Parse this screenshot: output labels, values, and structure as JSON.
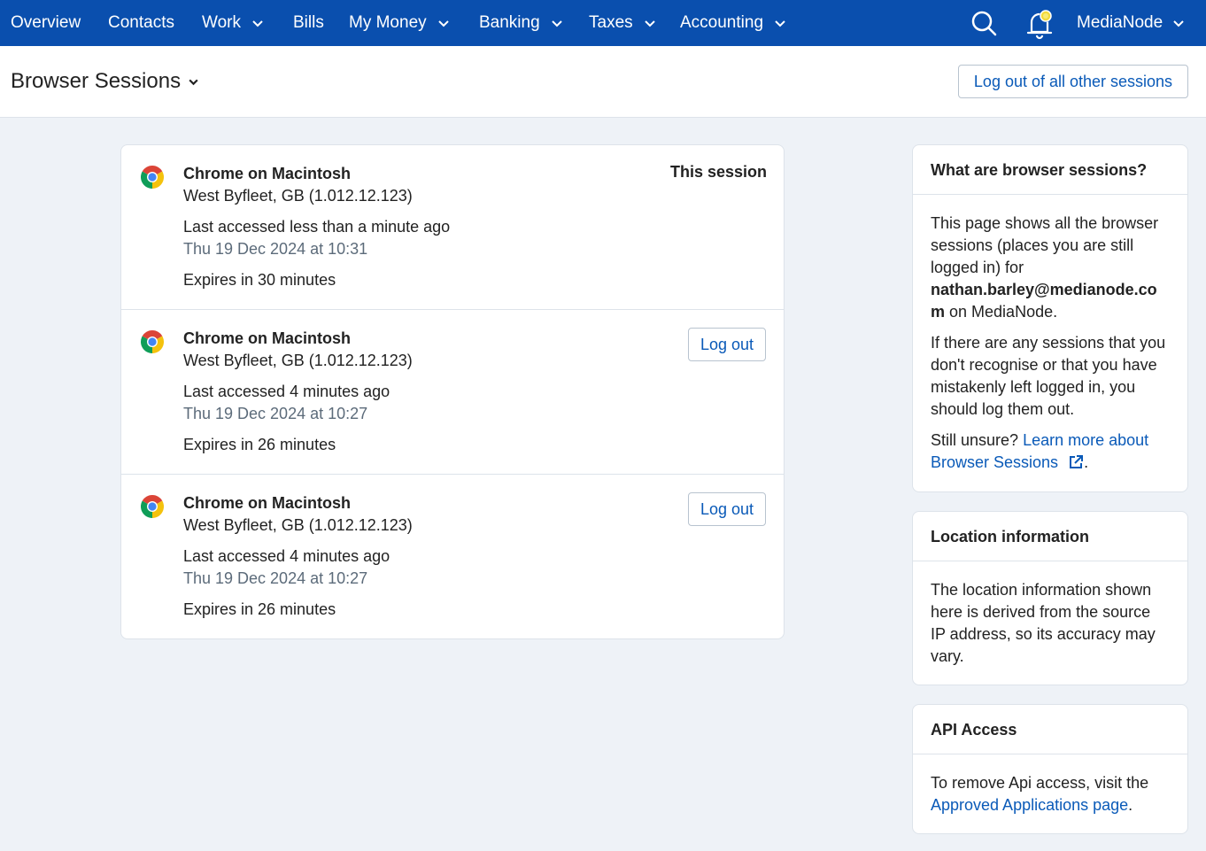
{
  "nav": {
    "items": [
      {
        "label": "Overview",
        "has_dropdown": false
      },
      {
        "label": "Contacts",
        "has_dropdown": false
      },
      {
        "label": "Work",
        "has_dropdown": true
      },
      {
        "label": "Bills",
        "has_dropdown": false
      },
      {
        "label": "My Money",
        "has_dropdown": true
      },
      {
        "label": "Banking",
        "has_dropdown": true
      },
      {
        "label": "Taxes",
        "has_dropdown": true
      },
      {
        "label": "Accounting",
        "has_dropdown": true
      }
    ],
    "account_label": "MediaNode",
    "search_icon": "search-icon",
    "notifications_icon": "bell-icon"
  },
  "header": {
    "title": "Browser Sessions",
    "logout_all_label": "Log out of all other sessions"
  },
  "sessions": [
    {
      "browser": "Chrome on Macintosh",
      "location": "West Byfleet, GB (1.012.12.123)",
      "last_accessed": "Last accessed less than a minute ago",
      "timestamp": "Thu 19 Dec 2024 at 10:31",
      "expires": "Expires in 30 minutes",
      "current_label": "This session"
    },
    {
      "browser": "Chrome on Macintosh",
      "location": "West Byfleet, GB (1.012.12.123)",
      "last_accessed": "Last accessed 4 minutes ago",
      "timestamp": "Thu 19 Dec 2024 at 10:27",
      "expires": "Expires in 26 minutes",
      "logout_label": "Log out"
    },
    {
      "browser": "Chrome on Macintosh",
      "location": "West Byfleet, GB (1.012.12.123)",
      "last_accessed": "Last accessed 4 minutes ago",
      "timestamp": "Thu 19 Dec 2024 at 10:27",
      "expires": "Expires in 26 minutes",
      "logout_label": "Log out"
    }
  ],
  "panels": {
    "what": {
      "title": "What are browser sessions?",
      "p1_line1": "This page shows all the browser",
      "p1_line2": "sessions (places you are still",
      "p1_line3": "logged in) for",
      "email_line1": "nathan.barley@medianode.co",
      "email_line2": "m",
      "p1_end": " on MediaNode.",
      "p2_line1": "If there are any sessions that you",
      "p2_line2": "don't recognise or that you have",
      "p2_line3": "mistakenly left logged in, you",
      "p2_line4": "should log them out.",
      "p3_prefix": "Still unsure? ",
      "p3_link1": "Learn more about",
      "p3_link2": "Browser Sessions",
      "p3_end": "."
    },
    "location": {
      "title": "Location information",
      "line1": "The location information shown",
      "line2": "here is derived from the source",
      "line3": "IP address, so its accuracy may",
      "line4": "vary."
    },
    "api": {
      "title": "API Access",
      "line1": "To remove Api access, visit the",
      "link": "Approved Applications page",
      "end": "."
    }
  },
  "colors": {
    "nav_bg": "#0a4fae",
    "link": "#0a5ab8",
    "page_bg": "#eef2f7"
  }
}
